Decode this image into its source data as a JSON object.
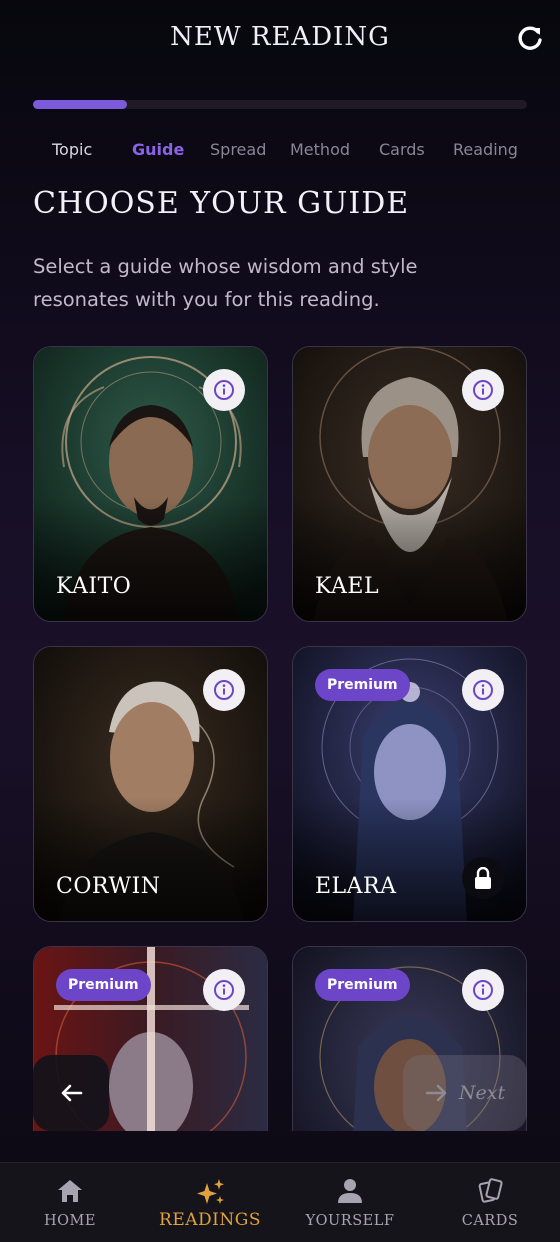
{
  "header": {
    "title": "NEW READING",
    "refresh_icon": "refresh-icon"
  },
  "progress": {
    "fraction": 0.19
  },
  "steps": [
    {
      "label": "Topic",
      "state": "done"
    },
    {
      "label": "Guide",
      "state": "active"
    },
    {
      "label": "Spread",
      "state": "todo"
    },
    {
      "label": "Method",
      "state": "todo"
    },
    {
      "label": "Cards",
      "state": "todo"
    },
    {
      "label": "Reading",
      "state": "todo"
    }
  ],
  "main": {
    "heading": "CHOOSE YOUR GUIDE",
    "subtitle": "Select a guide whose wisdom and style resonates with you for this reading."
  },
  "guides": [
    {
      "name": "KAITO",
      "premium": false,
      "locked": false
    },
    {
      "name": "KAEL",
      "premium": false,
      "locked": false
    },
    {
      "name": "CORWIN",
      "premium": false,
      "locked": false
    },
    {
      "name": "ELARA",
      "premium": true,
      "locked": true,
      "badge": "Premium"
    },
    {
      "name": "",
      "premium": true,
      "locked": false,
      "badge": "Premium"
    },
    {
      "name": "",
      "premium": true,
      "locked": false,
      "badge": "Premium"
    }
  ],
  "actions": {
    "next_label": "Next",
    "back_icon": "arrow-left-icon",
    "next_icon": "arrow-right-icon"
  },
  "nav": [
    {
      "label": "HOME",
      "icon": "home-icon",
      "active": false
    },
    {
      "label": "READINGS",
      "icon": "sparkles-icon",
      "active": true
    },
    {
      "label": "YOURSELF",
      "icon": "person-icon",
      "active": false
    },
    {
      "label": "CARDS",
      "icon": "cards-icon",
      "active": false
    }
  ],
  "colors": {
    "accent": "#7b5bd9",
    "active_step": "#8b64e6",
    "premium": "#6d45c8",
    "nav_active": "#e0a23a"
  }
}
